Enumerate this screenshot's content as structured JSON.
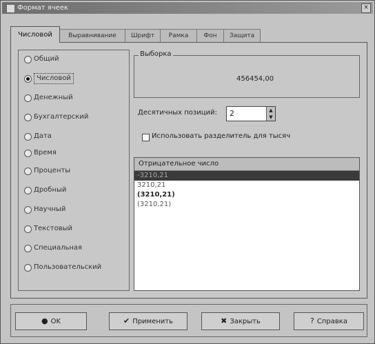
{
  "window": {
    "title": "Формат ячеек",
    "close_glyph": "×"
  },
  "tabs": [
    {
      "label": "Числовой",
      "active": true
    },
    {
      "label": "Выравнивание",
      "active": false
    },
    {
      "label": "Шрифт",
      "active": false
    },
    {
      "label": "Рамка",
      "active": false
    },
    {
      "label": "Фон",
      "active": false
    },
    {
      "label": "Защита",
      "active": false
    }
  ],
  "categories": [
    {
      "label": "Общий",
      "selected": false
    },
    {
      "label": "Числовой",
      "selected": true
    },
    {
      "label": "Денежный",
      "selected": false
    },
    {
      "label": "Бухгалтерский",
      "selected": false
    },
    {
      "label": "Дата",
      "selected": false
    },
    {
      "label": "Время",
      "selected": false
    },
    {
      "label": "Проценты",
      "selected": false
    },
    {
      "label": "Дробный",
      "selected": false
    },
    {
      "label": "Научный",
      "selected": false
    },
    {
      "label": "Текстовый",
      "selected": false
    },
    {
      "label": "Специальная",
      "selected": false
    },
    {
      "label": "Пользовательский",
      "selected": false
    }
  ],
  "sample": {
    "title": "Выборка",
    "value": "456454,00"
  },
  "decimals": {
    "label": "Десятичных позиций:",
    "value": "2"
  },
  "thousands": {
    "label": "Использовать разделитель для тысяч",
    "checked": false
  },
  "negative": {
    "header": "Отрицательное число",
    "rows": [
      "-3210,21",
      "3210,21",
      "(3210,21)",
      "(3210,21)"
    ]
  },
  "buttons": {
    "ok": "OK",
    "apply": "Применить",
    "close": "Закрыть",
    "help": "Справка"
  },
  "icons": {
    "ok": "ok-icon",
    "apply": "check-icon",
    "close": "x-icon",
    "help": "help-icon"
  }
}
